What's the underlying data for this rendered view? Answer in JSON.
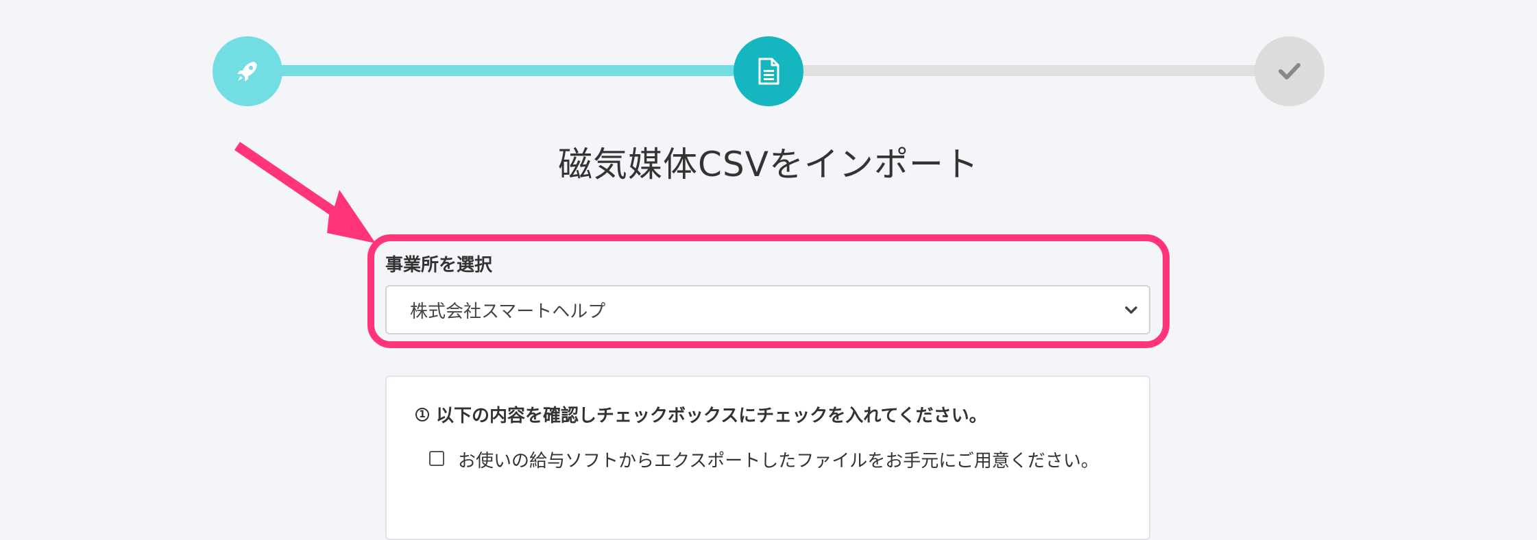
{
  "stepper": {
    "steps": [
      {
        "icon": "rocket-icon",
        "state": "done"
      },
      {
        "icon": "document-icon",
        "state": "current"
      },
      {
        "icon": "check-icon",
        "state": "todo"
      }
    ],
    "colors": {
      "done": "#72dde2",
      "current": "#16b6c0",
      "todo": "#dcdcdc"
    }
  },
  "page": {
    "title": "磁気媒体CSVをインポート"
  },
  "office": {
    "label": "事業所を選択",
    "selected": "株式会社スマートヘルプ"
  },
  "annotation": {
    "highlight_color": "#ff3479"
  },
  "instructions": {
    "number": "1",
    "heading": "以下の内容を確認しチェックボックスにチェックを入れてください。",
    "items": [
      {
        "text": "お使いの給与ソフトからエクスポートしたファイルをお手元にご用意ください。",
        "checked": false
      }
    ]
  }
}
